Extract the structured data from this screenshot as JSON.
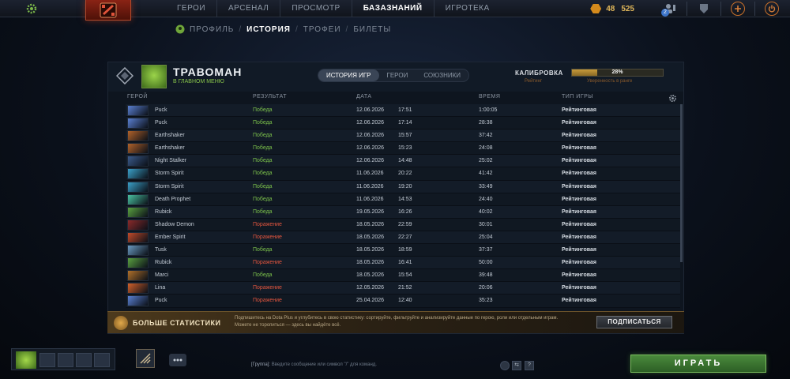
{
  "topnav": {
    "items": [
      "ГЕРОИ",
      "АРСЕНАЛ",
      "ПРОСМОТР",
      "БАЗАЗНАНИЙ",
      "ИГРОТЕКА"
    ],
    "active_index": 3
  },
  "currency": {
    "shards": "48",
    "gold": "525"
  },
  "notifications": {
    "count": "2"
  },
  "subnav": {
    "items": [
      "ПРОФИЛЬ",
      "ИСТОРИЯ",
      "ТРОФЕИ",
      "БИЛЕТЫ"
    ],
    "active_index": 1
  },
  "profile": {
    "name": "ТРАВОМАН",
    "status": "В ГЛАВНОМ МЕНЮ",
    "tabs": [
      "ИСТОРИЯ ИГР",
      "ГЕРОИ",
      "СОЮЗНИКИ"
    ],
    "active_tab": 0,
    "calibration_label": "КАЛИБРОВКА",
    "rating_label": "Рейтинг",
    "confidence_label": "Уверенность в ранге",
    "confidence_percent": 28,
    "confidence_text": "28%"
  },
  "columns": {
    "hero": "ГЕРОЙ",
    "result": "РЕЗУЛЬТАТ",
    "date": "ДАТА",
    "duration": "ВРЕМЯ",
    "type": "ТИП ИГРЫ"
  },
  "matches": [
    {
      "hero": "Puck",
      "result": "Победа",
      "win": true,
      "date": "12.06.2026",
      "time": "17:51",
      "duration": "1:00:05",
      "type": "Рейтинговая",
      "color": "#5a7fd0"
    },
    {
      "hero": "Puck",
      "result": "Победа",
      "win": true,
      "date": "12.06.2026",
      "time": "17:14",
      "duration": "28:38",
      "type": "Рейтинговая",
      "color": "#5a7fd0"
    },
    {
      "hero": "Earthshaker",
      "result": "Победа",
      "win": true,
      "date": "12.06.2026",
      "time": "15:57",
      "duration": "37:42",
      "type": "Рейтинговая",
      "color": "#b0622a"
    },
    {
      "hero": "Earthshaker",
      "result": "Победа",
      "win": true,
      "date": "12.06.2026",
      "time": "15:23",
      "duration": "24:08",
      "type": "Рейтинговая",
      "color": "#b0622a"
    },
    {
      "hero": "Night Stalker",
      "result": "Победа",
      "win": true,
      "date": "12.06.2026",
      "time": "14:48",
      "duration": "25:02",
      "type": "Рейтинговая",
      "color": "#3a5a8a"
    },
    {
      "hero": "Storm Spirit",
      "result": "Победа",
      "win": true,
      "date": "11.06.2026",
      "time": "20:22",
      "duration": "41:42",
      "type": "Рейтинговая",
      "color": "#3aa0c8"
    },
    {
      "hero": "Storm Spirit",
      "result": "Победа",
      "win": true,
      "date": "11.06.2026",
      "time": "19:20",
      "duration": "33:49",
      "type": "Рейтинговая",
      "color": "#3aa0c8"
    },
    {
      "hero": "Death Prophet",
      "result": "Победа",
      "win": true,
      "date": "11.06.2026",
      "time": "14:53",
      "duration": "24:40",
      "type": "Рейтинговая",
      "color": "#4ac0a0"
    },
    {
      "hero": "Rubick",
      "result": "Победа",
      "win": true,
      "date": "19.05.2026",
      "time": "16:26",
      "duration": "40:02",
      "type": "Рейтинговая",
      "color": "#5aa040"
    },
    {
      "hero": "Shadow Demon",
      "result": "Поражение",
      "win": false,
      "date": "18.05.2026",
      "time": "22:59",
      "duration": "30:01",
      "type": "Рейтинговая",
      "color": "#8a2a2a"
    },
    {
      "hero": "Ember Spirit",
      "result": "Поражение",
      "win": false,
      "date": "18.05.2026",
      "time": "22:27",
      "duration": "25:04",
      "type": "Рейтинговая",
      "color": "#c04a2a"
    },
    {
      "hero": "Tusk",
      "result": "Победа",
      "win": true,
      "date": "18.05.2026",
      "time": "18:59",
      "duration": "37:37",
      "type": "Рейтинговая",
      "color": "#6a9ac0"
    },
    {
      "hero": "Rubick",
      "result": "Поражение",
      "win": false,
      "date": "18.05.2026",
      "time": "16:41",
      "duration": "50:00",
      "type": "Рейтинговая",
      "color": "#5aa040"
    },
    {
      "hero": "Marci",
      "result": "Победа",
      "win": true,
      "date": "18.05.2026",
      "time": "15:54",
      "duration": "39:48",
      "type": "Рейтинговая",
      "color": "#b0702a"
    },
    {
      "hero": "Lina",
      "result": "Поражение",
      "win": false,
      "date": "12.05.2026",
      "time": "21:52",
      "duration": "20:06",
      "type": "Рейтинговая",
      "color": "#d0602a"
    },
    {
      "hero": "Puck",
      "result": "Поражение",
      "win": false,
      "date": "25.04.2026",
      "time": "12:40",
      "duration": "35:23",
      "type": "Рейтинговая",
      "color": "#5a7fd0"
    }
  ],
  "dota_plus": {
    "title": "БОЛЬШЕ СТАТИСТИКИ",
    "text": "Подпишитесь на Dota Plus и углубитесь в свою статистику: сортируйте, фильтруйте и анализируйте данные по герою, роли или отдельным играм. Можете не торопиться — здесь вы найдёте всё.",
    "button": "ПОДПИСАТЬСЯ"
  },
  "chat": {
    "channel": "[Группа]:",
    "placeholder": "Введите сообщение или символ \"/\" для команд."
  },
  "play_button": "ИГРАТЬ",
  "colors": {
    "win": "#7cc24b",
    "loss": "#e2553e",
    "play": "#3f7a33"
  }
}
